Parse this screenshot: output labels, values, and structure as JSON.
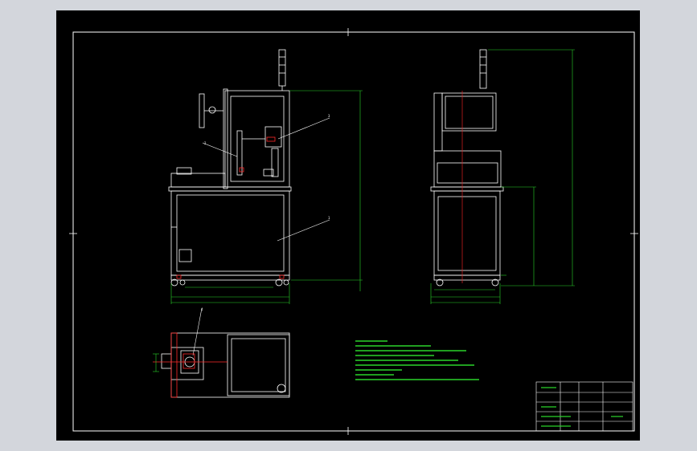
{
  "drawing": {
    "colors": {
      "background": "#000000",
      "frame": "#ffffff",
      "dimension": "#2bd42b",
      "centerline": "#e02020",
      "highlight": "#ff2a2a",
      "outside": "#d3d6dc"
    },
    "leader_labels": [
      "2",
      "3",
      "1",
      "4"
    ],
    "notes": [
      "",
      "",
      "",
      "",
      "",
      "",
      "",
      "",
      "",
      ""
    ],
    "title_block": {
      "drawing_name": "",
      "fields": [
        "",
        "",
        "",
        "",
        "",
        ""
      ]
    }
  }
}
